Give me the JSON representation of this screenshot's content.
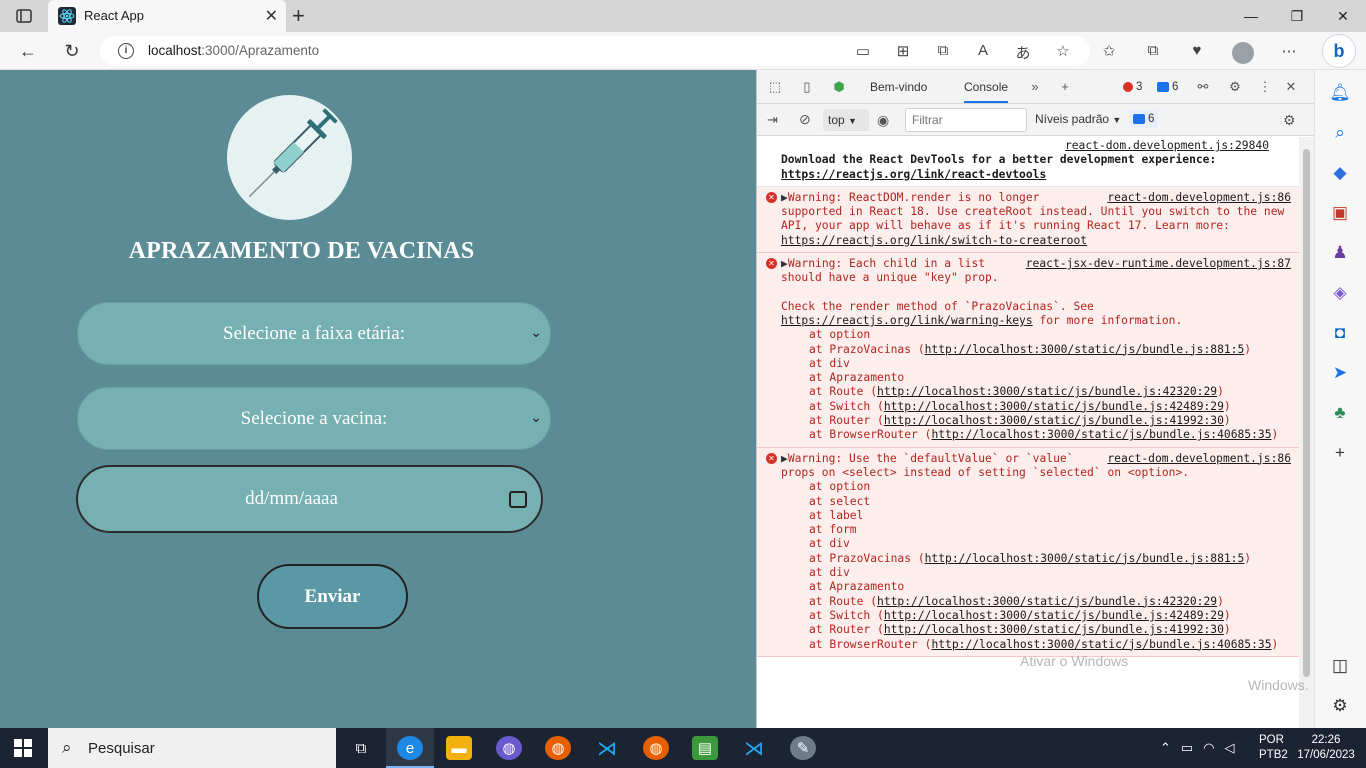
{
  "browser": {
    "tab_title": "React App",
    "url_host": "localhost",
    "url_path": ":3000/Aprazamento"
  },
  "page": {
    "title": "APRAZAMENTO DE VACINAS",
    "age_select_value": "Selecione a faixa etária:",
    "vaccine_select_value": "Selecione a vacina:",
    "date_placeholder": "dd/mm/aaaa",
    "submit_label": "Enviar"
  },
  "devtools": {
    "tabs": [
      "Bem-vindo",
      "Console"
    ],
    "error_count": "3",
    "message_count": "6",
    "context": "top",
    "filter_placeholder": "Filtrar",
    "levels_label": "Níveis padrão",
    "levels_count": "6",
    "messages": {
      "m0": {
        "source": "react-dom.development.js:29840",
        "text1": "Download the React DevTools for a better development experience: ",
        "link": "https://reactjs.org/link/react-devtools"
      },
      "m1": {
        "source": "react-dom.development.js:86",
        "text": "Warning: ReactDOM.render is no longer supported in React 18. Use createRoot instead. Until you switch to the new API, your app will behave as if it's running React 17. Learn more: ",
        "link": "https://reactjs.org/link/switch-to-createroot"
      },
      "m2": {
        "source": "react-jsx-dev-runtime.development.js:87",
        "text": "Warning: Each child in a list should have a unique \"key\" prop.",
        "render_text": "Check the render method of `PrazoVacinas`. See ",
        "link": "https://reactjs.org/link/warning-keys",
        "after_link": " for more information.",
        "stack": [
          {
            "name": "at option",
            "url": ""
          },
          {
            "name": "at PrazoVacinas (",
            "url": "http://localhost:3000/static/js/bundle.js:881:5"
          },
          {
            "name": "at div",
            "url": ""
          },
          {
            "name": "at Aprazamento",
            "url": ""
          },
          {
            "name": "at Route (",
            "url": "http://localhost:3000/static/js/bundle.js:42320:29"
          },
          {
            "name": "at Switch (",
            "url": "http://localhost:3000/static/js/bundle.js:42489:29"
          },
          {
            "name": "at Router (",
            "url": "http://localhost:3000/static/js/bundle.js:41992:30"
          },
          {
            "name": "at BrowserRouter (",
            "url": "http://localhost:3000/static/js/bundle.js:40685:35"
          }
        ]
      },
      "m3": {
        "source": "react-dom.development.js:86",
        "text": "Warning: Use the `defaultValue` or `value` props on <select> instead of setting `selected` on <option>.",
        "stack": [
          {
            "name": "at option",
            "url": ""
          },
          {
            "name": "at select",
            "url": ""
          },
          {
            "name": "at label",
            "url": ""
          },
          {
            "name": "at form",
            "url": ""
          },
          {
            "name": "at div",
            "url": ""
          },
          {
            "name": "at PrazoVacinas (",
            "url": "http://localhost:3000/static/js/bundle.js:881:5"
          },
          {
            "name": "at div",
            "url": ""
          },
          {
            "name": "at Aprazamento",
            "url": ""
          },
          {
            "name": "at Route (",
            "url": "http://localhost:3000/static/js/bundle.js:42320:29"
          },
          {
            "name": "at Switch (",
            "url": "http://localhost:3000/static/js/bundle.js:42489:29"
          },
          {
            "name": "at Router (",
            "url": "http://localhost:3000/static/js/bundle.js:41992:30"
          },
          {
            "name": "at BrowserRouter (",
            "url": "http://localhost:3000/static/js/bundle.js:40685:35"
          }
        ]
      }
    }
  },
  "watermark": {
    "line1": "Ativar o Windows",
    "line2": "Windows."
  },
  "taskbar": {
    "search_label": "Pesquisar",
    "lang1": "POR",
    "lang2": "PTB2",
    "time": "22:26",
    "date": "17/06/2023"
  },
  "colors": {
    "page_bg": "#5b8b94",
    "field_bg": "#76b0b2",
    "button_bg": "#5a98a6",
    "warning_bg": "#fdeeee",
    "taskbar_bg": "#1c2433"
  }
}
